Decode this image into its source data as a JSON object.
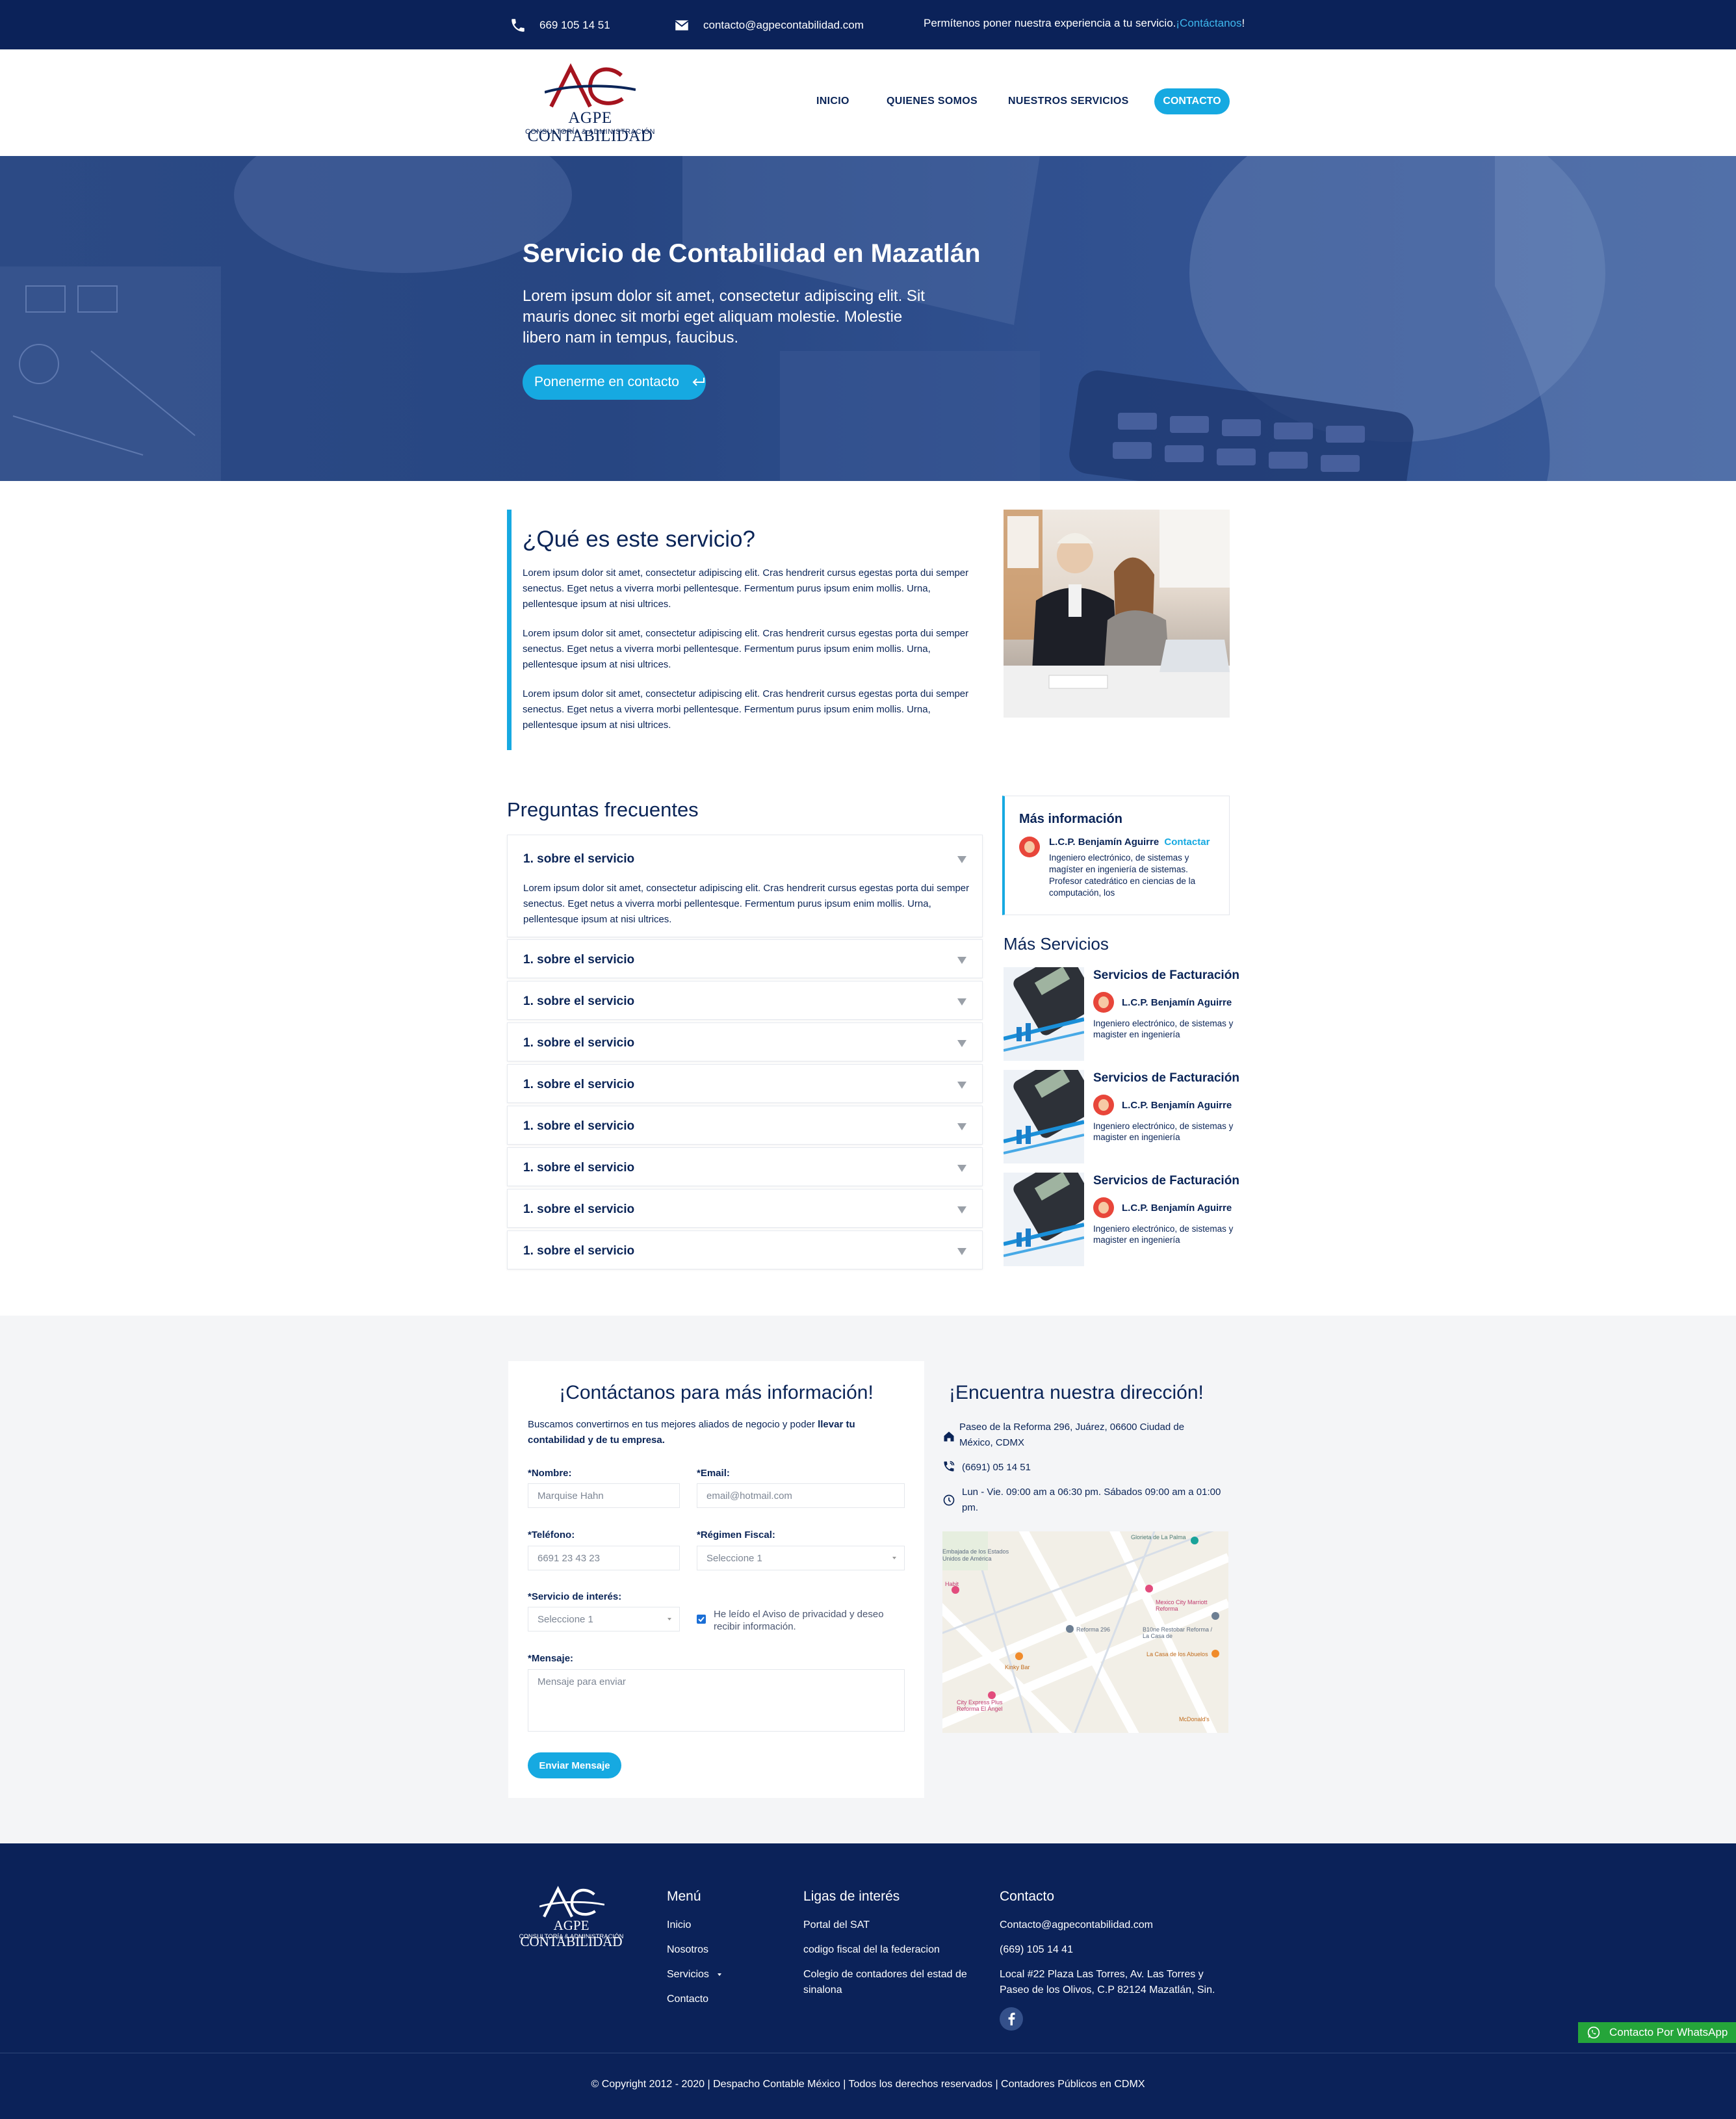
{
  "topbar": {
    "phone": "669 105 14 51",
    "email": "contacto@agpecontabilidad.com",
    "promo": "Permítenos poner nuestra experiencia a tu servicio. ",
    "promo_link": "¡Contáctanos",
    "promo_end": "!"
  },
  "logo": {
    "mark": "AC",
    "name": "AGPE CONTABILIDAD",
    "tagline": "CONSULTORÍA & ADMINISTRACIÓN"
  },
  "nav": {
    "items": [
      "INICIO",
      "QUIENES SOMOS",
      "NUESTROS SERVICIOS"
    ],
    "cta": "CONTACTO"
  },
  "hero": {
    "title": "Servicio de Contabilidad en Mazatlán",
    "text": "Lorem ipsum dolor sit amet, consectetur adipiscing elit. Sit mauris donec sit morbi eget aliquam molestie. Molestie libero nam in tempus, faucibus.",
    "button": "Ponenerme en contacto"
  },
  "service": {
    "title": "¿Qué es este servicio?",
    "paragraphs": [
      "Lorem ipsum dolor sit amet, consectetur adipiscing elit. Cras hendrerit cursus egestas porta dui semper senectus. Eget netus a viverra morbi pellentesque. Fermentum purus ipsum enim mollis. Urna, pellentesque ipsum at nisi ultrices.",
      "Lorem ipsum dolor sit amet, consectetur adipiscing elit. Cras hendrerit cursus egestas porta dui semper senectus. Eget netus a viverra morbi pellentesque. Fermentum purus ipsum enim mollis. Urna, pellentesque ipsum at nisi ultrices.",
      "Lorem ipsum dolor sit amet, consectetur adipiscing elit. Cras hendrerit cursus egestas porta dui semper senectus. Eget netus a viverra morbi pellentesque. Fermentum purus ipsum enim mollis. Urna, pellentesque ipsum at nisi ultrices."
    ]
  },
  "faq": {
    "title": "Preguntas frecuentes",
    "open_answer": "Lorem ipsum dolor sit amet, consectetur adipiscing elit. Cras hendrerit cursus egestas porta dui semper senectus. Eget netus a viverra morbi pellentesque. Fermentum purus ipsum enim mollis. Urna, pellentesque ipsum at nisi ultrices.",
    "items": [
      "1. sobre el servicio",
      "1. sobre el servicio",
      "1. sobre el servicio",
      "1. sobre el servicio",
      "1. sobre el servicio",
      "1. sobre el servicio",
      "1. sobre el servicio",
      "1. sobre el servicio",
      "1. sobre el servicio"
    ]
  },
  "sidebar": {
    "info_title": "Más información",
    "person": "L.C.P. Benjamín Aguirre",
    "contact_link": "Contactar",
    "bio": "Ingeniero electrónico, de sistemas y magíster en ingeniería de sistemas. Profesor catedrático en ciencias de la computación, los",
    "more_title": "Más Servicios",
    "services": [
      {
        "title": "Servicios de Facturación",
        "person": "L.C.P. Benjamín Aguirre",
        "bio": "Ingeniero electrónico, de sistemas y magister en ingeniería"
      },
      {
        "title": "Servicios de Facturación",
        "person": "L.C.P. Benjamín Aguirre",
        "bio": "Ingeniero electrónico, de sistemas y magister en ingeniería"
      },
      {
        "title": "Servicios de Facturación",
        "person": "L.C.P. Benjamín Aguirre",
        "bio": "Ingeniero electrónico, de sistemas y magister en ingeniería"
      }
    ]
  },
  "contact": {
    "title": "¡Contáctanos para más información!",
    "intro": "Buscamos convertirnos en tus mejores aliados de negocio y poder ",
    "intro_bold": "llevar tu contabilidad y de tu empresa.",
    "name_label": "*Nombre:",
    "name_value": "Marquise Hahn",
    "email_label": "*Email:",
    "email_placeholder": "email@hotmail.com",
    "phone_label": "*Teléfono:",
    "phone_value": "6691 23 43 23",
    "regimen_label": "*Régimen Fiscal:",
    "regimen_value": "Seleccione 1",
    "interest_label": "*Servicio de interés:",
    "interest_value": "Seleccione 1",
    "privacy": "He leído el Aviso de privacidad y deseo recibir información.",
    "message_label": "*Mensaje:",
    "message_placeholder": "Mensaje para enviar",
    "send": "Enviar Mensaje"
  },
  "address": {
    "title": "¡Encuentra nuestra dirección!",
    "street": "Paseo de la Reforma 296, Juárez, 06600 Ciudad de México, CDMX",
    "phone": "(6691) 05 14 51",
    "hours": "Lun - Vie. 09:00 am a 06:30 pm. Sábados 09:00 am a 01:00 pm.",
    "map_labels": [
      "Glorieta de La Palma",
      "Embajada de los Estados Unidos de América",
      "Reforma 296",
      "Mexico City Marriott Reforma",
      "B10ne Restobar Reforma / La Casa de",
      "La Casa de los Abuelos",
      "Kinky Bar",
      "City Express Plus Reforma El Ángel",
      "McDonald's",
      "Habit"
    ]
  },
  "footer": {
    "logo_mark": "AC",
    "logo_name": "AGPE CONTABILIDAD",
    "logo_tagline": "CONSULTORÍA & ADMINISTRACIÓN",
    "menu_title": "Menú",
    "menu": [
      "Inicio",
      "Nosotros",
      "Servicios",
      "Contacto"
    ],
    "links_title": "Ligas de interés",
    "links": [
      "Portal del SAT",
      "codigo  fiscal del la federacion",
      "Colegio de contadores del estad de sinalona"
    ],
    "contact_title": "Contacto",
    "contact_email": "Contacto@agpecontabilidad.com",
    "contact_phone": "(669) 105 14 41",
    "contact_address": "Local #22 Plaza Las Torres, Av. Las Torres y Paseo de los Olivos, C.P 82124 Mazatlán, Sin.",
    "copyright": "© Copyright 2012 - 2020 | Despacho Contable México | Todos los derechos reservados | Contadores Públicos en CDMX",
    "whatsapp": "Contacto Por WhatsApp"
  },
  "colors": {
    "navy": "#0b2259",
    "accent": "#16a9e1",
    "brand_red": "#a5141f",
    "whatsapp": "#25a53a"
  },
  "icons": [
    "phone-icon",
    "mail-icon",
    "return-icon",
    "home-icon",
    "phone-call-icon",
    "clock-icon",
    "facebook-icon",
    "whatsapp-icon",
    "chevron-down-icon"
  ]
}
